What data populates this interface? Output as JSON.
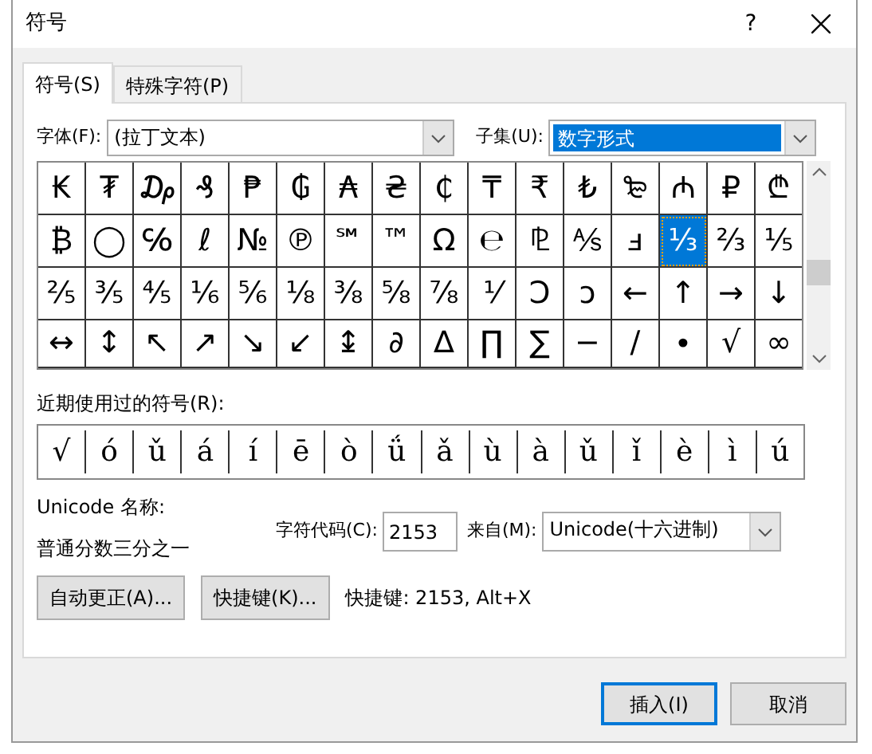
{
  "window": {
    "title": "符号",
    "help": "?"
  },
  "tabs": [
    {
      "label": "符号(S)",
      "selected": true
    },
    {
      "label": "特殊字符(P)",
      "selected": false
    }
  ],
  "font_field": {
    "label": "字体(F):",
    "value": "(拉丁文本)"
  },
  "subset_field": {
    "label": "子集(U):",
    "value": "数字形式"
  },
  "symbol_rows": [
    [
      {
        "char": "₭",
        "selected": false
      },
      {
        "char": "₮",
        "selected": false
      },
      {
        "char": "₯",
        "selected": false
      },
      {
        "char": "₰",
        "selected": false
      },
      {
        "char": "₱",
        "selected": false
      },
      {
        "char": "₲",
        "selected": false
      },
      {
        "char": "₳",
        "selected": false
      },
      {
        "char": "₴",
        "selected": false
      },
      {
        "char": "₵",
        "selected": false
      },
      {
        "char": "₸",
        "selected": false
      },
      {
        "char": "₹",
        "selected": false
      },
      {
        "char": "₺",
        "selected": false
      },
      {
        "char": "₻",
        "selected": false
      },
      {
        "char": "₼",
        "selected": false
      },
      {
        "char": "₽",
        "selected": false
      },
      {
        "char": "₾",
        "selected": false
      }
    ],
    [
      {
        "char": "₿",
        "selected": false
      },
      {
        "char": "◯",
        "selected": false
      },
      {
        "char": "℅",
        "selected": false
      },
      {
        "char": "ℓ",
        "selected": false
      },
      {
        "char": "№",
        "selected": false
      },
      {
        "char": "℗",
        "selected": false
      },
      {
        "char": "℠",
        "selected": false
      },
      {
        "char": "™",
        "selected": false
      },
      {
        "char": "Ω",
        "selected": false
      },
      {
        "char": "℮",
        "selected": false
      },
      {
        "char": "⅊",
        "selected": false
      },
      {
        "char": "⅍",
        "selected": false
      },
      {
        "char": "ⅎ",
        "selected": false
      },
      {
        "char": "⅓",
        "selected": true
      },
      {
        "char": "⅔",
        "selected": false
      },
      {
        "char": "⅕",
        "selected": false
      }
    ],
    [
      {
        "char": "⅖",
        "selected": false
      },
      {
        "char": "⅗",
        "selected": false
      },
      {
        "char": "⅘",
        "selected": false
      },
      {
        "char": "⅙",
        "selected": false
      },
      {
        "char": "⅚",
        "selected": false
      },
      {
        "char": "⅛",
        "selected": false
      },
      {
        "char": "⅜",
        "selected": false
      },
      {
        "char": "⅝",
        "selected": false
      },
      {
        "char": "⅞",
        "selected": false
      },
      {
        "char": "⅟",
        "selected": false
      },
      {
        "char": "Ↄ",
        "selected": false
      },
      {
        "char": "ↄ",
        "selected": false
      },
      {
        "char": "←",
        "selected": false
      },
      {
        "char": "↑",
        "selected": false
      },
      {
        "char": "→",
        "selected": false
      },
      {
        "char": "↓",
        "selected": false
      }
    ],
    [
      {
        "char": "↔",
        "selected": false
      },
      {
        "char": "↕",
        "selected": false
      },
      {
        "char": "↖",
        "selected": false
      },
      {
        "char": "↗",
        "selected": false
      },
      {
        "char": "↘",
        "selected": false
      },
      {
        "char": "↙",
        "selected": false
      },
      {
        "char": "↨",
        "selected": false
      },
      {
        "char": "∂",
        "selected": false
      },
      {
        "char": "∆",
        "selected": false
      },
      {
        "char": "∏",
        "selected": false
      },
      {
        "char": "∑",
        "selected": false
      },
      {
        "char": "−",
        "selected": false
      },
      {
        "char": "∕",
        "selected": false
      },
      {
        "char": "∙",
        "selected": false
      },
      {
        "char": "√",
        "selected": false
      },
      {
        "char": "∞",
        "selected": false
      }
    ]
  ],
  "recent_label": "近期使用过的符号(R):",
  "recent_symbols": [
    "√",
    "ó",
    "ǔ",
    "á",
    "í",
    "ē",
    "ò",
    "ǘ",
    "ǎ",
    "ù",
    "à",
    "ǔ",
    "ǐ",
    "è",
    "ì",
    "ú"
  ],
  "unicode_name_label": "Unicode 名称:",
  "unicode_name": "普通分数三分之一",
  "char_code": {
    "label": "字符代码(C):",
    "value": "2153"
  },
  "from_field": {
    "label": "来自(M):",
    "value": "Unicode(十六进制)"
  },
  "autocorrect_button": "自动更正(A)...",
  "shortcut_button": "快捷键(K)...",
  "shortcut_text": "快捷键: 2153, Alt+X",
  "insert_button": "插入(I)",
  "cancel_button": "取消"
}
